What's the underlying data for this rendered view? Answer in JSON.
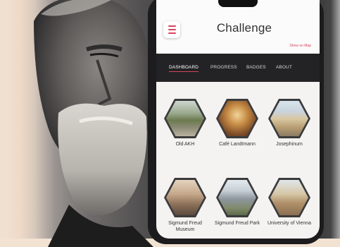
{
  "app": {
    "title": "Challenge",
    "header_link": "Show on Map"
  },
  "tabs": [
    {
      "label": "DASHBOARD",
      "active": true
    },
    {
      "label": "PROGRESS",
      "active": false
    },
    {
      "label": "BADGES",
      "active": false
    },
    {
      "label": "ABOUT",
      "active": false
    }
  ],
  "tiles": [
    {
      "label": "Old AKH",
      "icon": "old-akh-photo"
    },
    {
      "label": "Café Landtmann",
      "icon": "cafe-landtmann-photo"
    },
    {
      "label": "Josephinum",
      "icon": "josephinum-photo"
    },
    {
      "label": "Sigmund Freud Museum",
      "icon": "sigmund-freud-museum-photo"
    },
    {
      "label": "Sigmund Freud Park",
      "icon": "sigmund-freud-park-photo"
    },
    {
      "label": "University of Vienna",
      "icon": "university-of-vienna-photo"
    }
  ],
  "colors": {
    "accent": "#d9435f",
    "tabbar": "#232325",
    "screen_bg": "#f4f3f2"
  }
}
